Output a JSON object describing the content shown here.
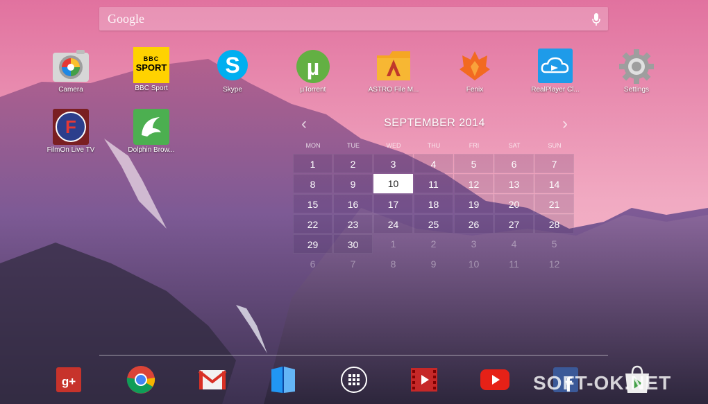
{
  "search": {
    "placeholder": "Google"
  },
  "apps": [
    {
      "label": "Camera",
      "icon": "camera-icon"
    },
    {
      "label": "BBC Sport",
      "icon": "bbc-sport-icon",
      "icon_text_top": "BBC",
      "icon_text_bottom": "SPORT"
    },
    {
      "label": "Skype",
      "icon": "skype-icon"
    },
    {
      "label": "µTorrent",
      "icon": "utorrent-icon"
    },
    {
      "label": "ASTRO File M...",
      "icon": "astro-file-manager-icon"
    },
    {
      "label": "Fenix",
      "icon": "fenix-icon"
    },
    {
      "label": "RealPlayer Cl...",
      "icon": "realplayer-icon"
    },
    {
      "label": "Settings",
      "icon": "settings-gear-icon"
    },
    {
      "label": "FilmOn Live TV",
      "icon": "filmon-icon"
    },
    {
      "label": "Dolphin Brow...",
      "icon": "dolphin-browser-icon"
    }
  ],
  "calendar": {
    "title": "SEPTEMBER 2014",
    "weekdays": [
      "MON",
      "TUE",
      "WED",
      "THU",
      "FRI",
      "SAT",
      "SUN"
    ],
    "weeks": [
      [
        "1",
        "2",
        "3",
        "4",
        "5",
        "6",
        "7"
      ],
      [
        "8",
        "9",
        "10",
        "11",
        "12",
        "13",
        "14"
      ],
      [
        "15",
        "16",
        "17",
        "18",
        "19",
        "20",
        "21"
      ],
      [
        "22",
        "23",
        "24",
        "25",
        "26",
        "27",
        "28"
      ],
      [
        "29",
        "30",
        "1",
        "2",
        "3",
        "4",
        "5"
      ],
      [
        "6",
        "7",
        "8",
        "9",
        "10",
        "11",
        "12"
      ]
    ],
    "today": "10"
  },
  "dock": [
    {
      "icon": "google-plus-icon"
    },
    {
      "icon": "chrome-icon"
    },
    {
      "icon": "gmail-icon"
    },
    {
      "icon": "play-books-icon"
    },
    {
      "icon": "app-drawer-icon"
    },
    {
      "icon": "play-movies-icon"
    },
    {
      "icon": "youtube-icon"
    },
    {
      "icon": "facebook-icon"
    },
    {
      "icon": "play-store-icon"
    }
  ],
  "watermark": "SOFT-OK.NET",
  "colors": {
    "sky_top": "#e57aa6",
    "sky_bottom": "#f3b4c6",
    "mountain": "#6a4a86"
  }
}
